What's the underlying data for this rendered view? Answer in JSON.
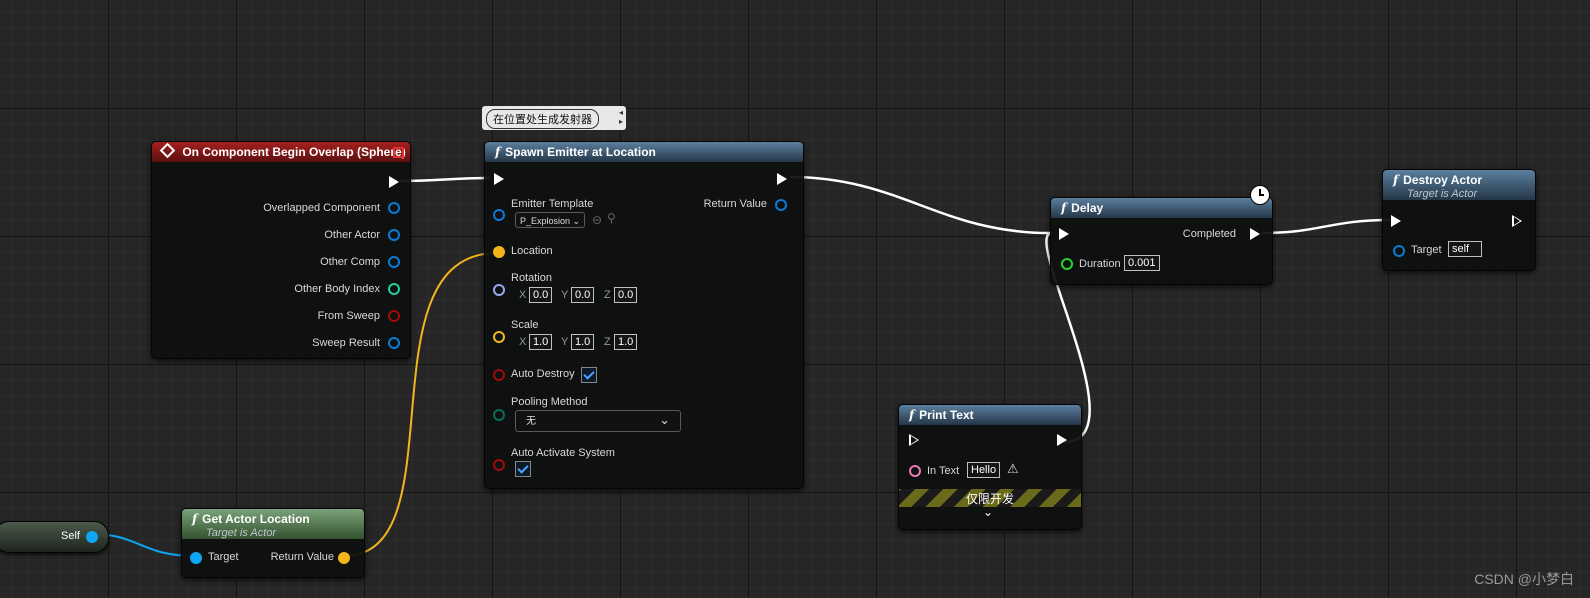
{
  "event_node": {
    "title": "On Component Begin Overlap (Sphere)",
    "outputs": [
      "Overlapped Component",
      "Other Actor",
      "Other Comp",
      "Other Body Index",
      "From Sweep",
      "Sweep Result"
    ]
  },
  "spawn_node": {
    "tooltip": "在位置处生成发射器",
    "title": "Spawn Emitter at Location",
    "emitter_template_label": "Emitter Template",
    "emitter_template_value": "P_Explosion",
    "return_value_label": "Return Value",
    "location_label": "Location",
    "rotation_label": "Rotation",
    "rotation": {
      "x": "0.0",
      "y": "0.0",
      "z": "0.0"
    },
    "scale_label": "Scale",
    "scale": {
      "x": "1.0",
      "y": "1.0",
      "z": "1.0"
    },
    "axis": {
      "x": "X",
      "y": "Y",
      "z": "Z"
    },
    "auto_destroy_label": "Auto Destroy",
    "pooling_label": "Pooling Method",
    "pooling_value": "无",
    "auto_activate_label": "Auto Activate System"
  },
  "delay_node": {
    "title": "Delay",
    "completed_label": "Completed",
    "duration_label": "Duration",
    "duration_value": "0.001"
  },
  "destroy_node": {
    "title": "Destroy Actor",
    "subtitle": "Target is Actor",
    "target_label": "Target",
    "target_value": "self"
  },
  "print_node": {
    "title": "Print Text",
    "in_text_label": "In Text",
    "in_text_value": "Hello",
    "dev_only_label": "仅限开发"
  },
  "self_node": {
    "label": "Self"
  },
  "get_location_node": {
    "title": "Get Actor Location",
    "subtitle": "Target is Actor",
    "target_label": "Target",
    "return_value_label": "Return Value"
  },
  "watermark": "CSDN @小梦白",
  "colors": {
    "exec_wire": "#ffffff",
    "vector_wire": "#f2b51c",
    "object_wire": "#0ea5f2",
    "struct_pin": "#0a7bd6",
    "int_pin": "#1fcf9c",
    "bool_pin": "#a00b0b",
    "rotator_pin": "#9aa8f0",
    "enum_pin": "#0c6b5a",
    "string_pin": "#e87ab5"
  }
}
